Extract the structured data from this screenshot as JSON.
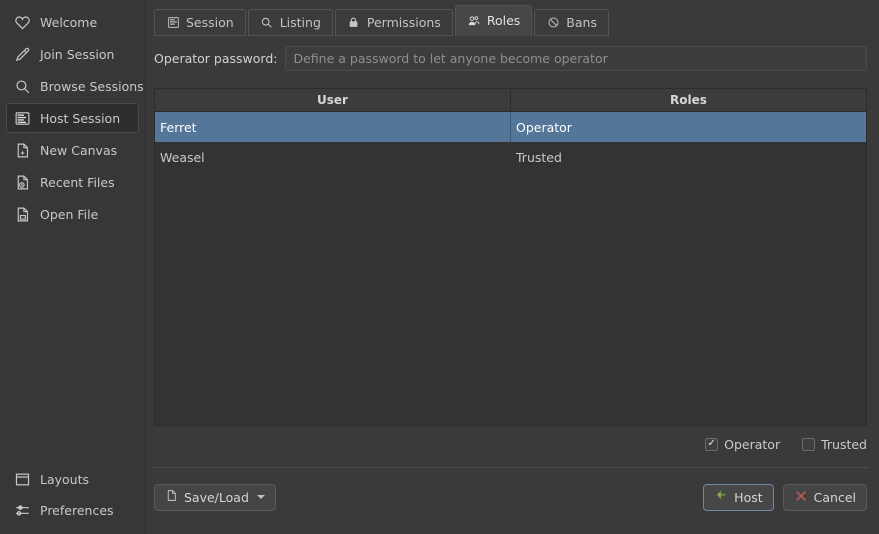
{
  "sidebar": {
    "top_items": [
      {
        "label": "Welcome",
        "icon": "heart-icon",
        "selected": false
      },
      {
        "label": "Join Session",
        "icon": "pen-icon",
        "selected": false
      },
      {
        "label": "Browse Sessions",
        "icon": "search-icon",
        "selected": false
      },
      {
        "label": "Host Session",
        "icon": "server-icon",
        "selected": true
      },
      {
        "label": "New Canvas",
        "icon": "new-document-icon",
        "selected": false
      },
      {
        "label": "Recent Files",
        "icon": "recent-document-icon",
        "selected": false
      },
      {
        "label": "Open File",
        "icon": "open-document-icon",
        "selected": false
      }
    ],
    "bottom_items": [
      {
        "label": "Layouts",
        "icon": "window-layout-icon"
      },
      {
        "label": "Preferences",
        "icon": "sliders-icon"
      }
    ]
  },
  "tabs": [
    {
      "label": "Session",
      "icon": "list-icon",
      "active": false
    },
    {
      "label": "Listing",
      "icon": "search-icon",
      "active": false
    },
    {
      "label": "Permissions",
      "icon": "lock-icon",
      "active": false
    },
    {
      "label": "Roles",
      "icon": "users-icon",
      "active": true
    },
    {
      "label": "Bans",
      "icon": "ban-icon",
      "active": false
    }
  ],
  "password": {
    "label": "Operator password:",
    "value": "",
    "placeholder": "Define a password to let anyone become operator"
  },
  "table": {
    "columns": [
      "User",
      "Roles"
    ],
    "rows": [
      {
        "user": "Ferret",
        "roles": "Operator",
        "selected": true
      },
      {
        "user": "Weasel",
        "roles": "Trusted",
        "selected": false
      }
    ]
  },
  "role_checkboxes": [
    {
      "label": "Operator",
      "checked": true,
      "mark": "✓"
    },
    {
      "label": "Trusted",
      "checked": false,
      "mark": ""
    }
  ],
  "buttons": {
    "save_load": {
      "label": "Save/Load",
      "icon": "document-icon"
    },
    "host": {
      "label": "Host",
      "icon": "green-arrow-icon"
    },
    "cancel": {
      "label": "Cancel",
      "icon": "red-x-icon"
    }
  },
  "colors": {
    "selection": "#547699",
    "accent_green": "#8faa5e",
    "accent_red": "#b05a5a",
    "focus_border": "#6d8aa8"
  }
}
